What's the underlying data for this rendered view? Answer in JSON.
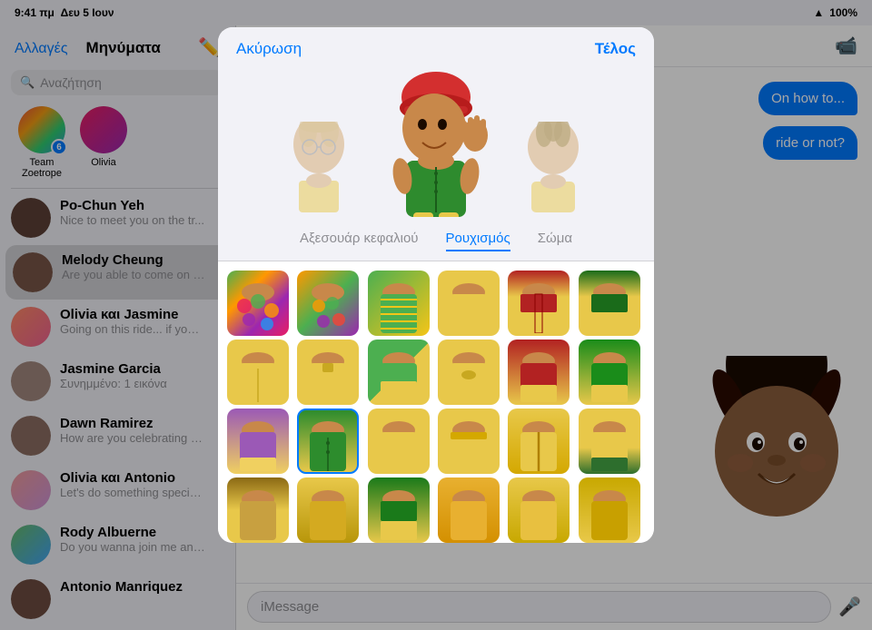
{
  "statusBar": {
    "time": "9:41 πμ",
    "day": "Δευ 5 Ιουν",
    "wifi": "WiFi",
    "battery": "100%"
  },
  "sidebar": {
    "backLabel": "Αλλαγές",
    "title": "Μηνύματα",
    "searchPlaceholder": "Αναζήτηση",
    "stories": [
      {
        "label": "Team Zoetrope",
        "badge": "6"
      },
      {
        "label": "Olivia",
        "badge": null
      }
    ],
    "conversations": [
      {
        "name": "Po-Chun Yeh",
        "preview": "Nice to meet you on the tr...",
        "time": ""
      },
      {
        "name": "Melody Cheung",
        "preview": "Are you able to come on th...",
        "time": "",
        "active": true
      },
      {
        "name": "Olivia και Jasmine",
        "preview": "Going on this ride... if you c...",
        "time": ""
      },
      {
        "name": "Jasmine Garcia",
        "preview": "Συνημμένο: 1 εικόνα",
        "time": ""
      },
      {
        "name": "Dawn Ramirez",
        "preview": "How are you celebrating y...",
        "time": ""
      },
      {
        "name": "Olivia και Antonio",
        "preview": "Let's do something specia...",
        "time": ""
      },
      {
        "name": "Rody Albuerne",
        "preview": "Do you wanna join me and...",
        "time": ""
      },
      {
        "name": "Antonio Manriquez",
        "preview": "",
        "time": ""
      }
    ]
  },
  "chat": {
    "videoIconLabel": "video-call",
    "messageBubble1": "On how to...",
    "messageBubble2": "ride or not?",
    "inputPlaceholder": "iMessage"
  },
  "modal": {
    "cancelLabel": "Ακύρωση",
    "doneLabel": "Τέλος",
    "tabs": [
      {
        "label": "Αξεσουάρ κεφαλιού",
        "active": false
      },
      {
        "label": "Ρουχισμός",
        "active": true
      },
      {
        "label": "Σώμα",
        "active": false
      }
    ],
    "clothingItems": [
      {
        "style": "cloth-1",
        "selected": false
      },
      {
        "style": "cloth-2",
        "selected": false
      },
      {
        "style": "cloth-3",
        "selected": false
      },
      {
        "style": "cloth-4",
        "selected": false
      },
      {
        "style": "cloth-5",
        "selected": false
      },
      {
        "style": "cloth-6",
        "selected": false
      },
      {
        "style": "cloth-7",
        "selected": false
      },
      {
        "style": "cloth-8",
        "selected": false
      },
      {
        "style": "cloth-9",
        "selected": false
      },
      {
        "style": "cloth-10",
        "selected": false
      },
      {
        "style": "cloth-11",
        "selected": false
      },
      {
        "style": "cloth-12",
        "selected": false
      },
      {
        "style": "cloth-purple",
        "selected": false
      },
      {
        "style": "cloth-green-sel",
        "selected": true
      },
      {
        "style": "cloth-plain1",
        "selected": false
      },
      {
        "style": "cloth-plain2",
        "selected": false
      },
      {
        "style": "cloth-zip",
        "selected": false
      },
      {
        "style": "cloth-stripe",
        "selected": false
      },
      {
        "style": "cloth-dark1",
        "selected": false
      },
      {
        "style": "cloth-dark2",
        "selected": false
      },
      {
        "style": "cloth-green2",
        "selected": false
      },
      {
        "style": "cloth-row4-1",
        "selected": false
      },
      {
        "style": "cloth-row4-2",
        "selected": false
      },
      {
        "style": "cloth-row4-3",
        "selected": false
      }
    ]
  }
}
